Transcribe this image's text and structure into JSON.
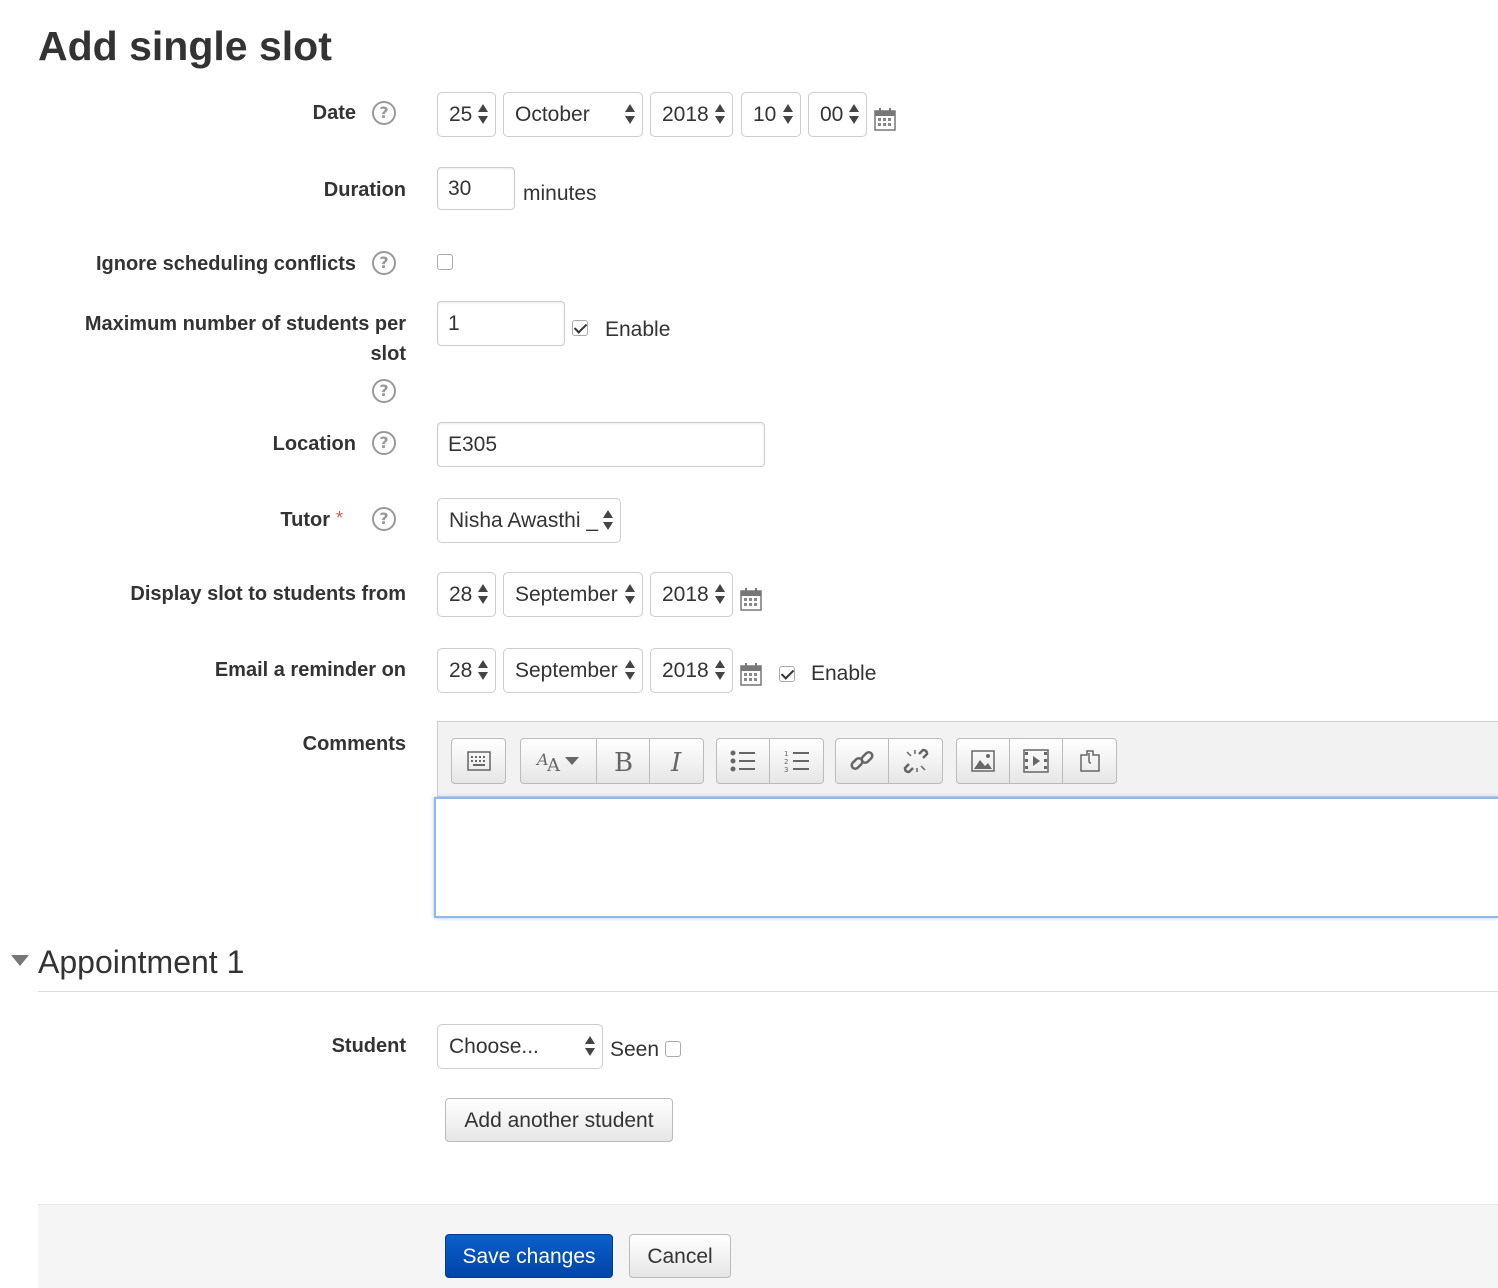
{
  "page": {
    "title": "Add single slot"
  },
  "form": {
    "date": {
      "label": "Date",
      "day": "25",
      "month": "October",
      "year": "2018",
      "hour": "10",
      "minute": "00"
    },
    "duration": {
      "label": "Duration",
      "value": "30",
      "unit": "minutes"
    },
    "ignore_conflicts": {
      "label": "Ignore scheduling conflicts",
      "checked": false
    },
    "max_students": {
      "label_line1": "Maximum number of students per",
      "label_line2": "slot",
      "value": "1",
      "enable_label": "Enable",
      "enabled": true
    },
    "location": {
      "label": "Location",
      "value": "E305"
    },
    "tutor": {
      "label": "Tutor",
      "required_mark": "*",
      "value": "Nisha Awasthi _"
    },
    "display_from": {
      "label": "Display slot to students from",
      "day": "28",
      "month": "September",
      "year": "2018"
    },
    "email_reminder": {
      "label": "Email a reminder on",
      "day": "28",
      "month": "September",
      "year": "2018",
      "enable_label": "Enable",
      "enabled": true
    },
    "comments": {
      "label": "Comments",
      "value": ""
    }
  },
  "editor": {
    "toolbar": [
      [
        "toggle-toolbar-icon"
      ],
      [
        "font-style-icon",
        "bold-icon",
        "italic-icon"
      ],
      [
        "unordered-list-icon",
        "ordered-list-icon"
      ],
      [
        "link-icon",
        "unlink-icon"
      ],
      [
        "image-icon",
        "media-icon",
        "manage-files-icon"
      ]
    ]
  },
  "appointment": {
    "title": "Appointment 1",
    "student_label": "Student",
    "student_value": "Choose...",
    "seen_label": "Seen",
    "seen_checked": false,
    "add_student_label": "Add another student"
  },
  "footer": {
    "save_label": "Save changes",
    "cancel_label": "Cancel"
  },
  "colors": {
    "primary": "#0b5fcc",
    "required": "#d9534f",
    "focus": "#8fb8f2"
  }
}
